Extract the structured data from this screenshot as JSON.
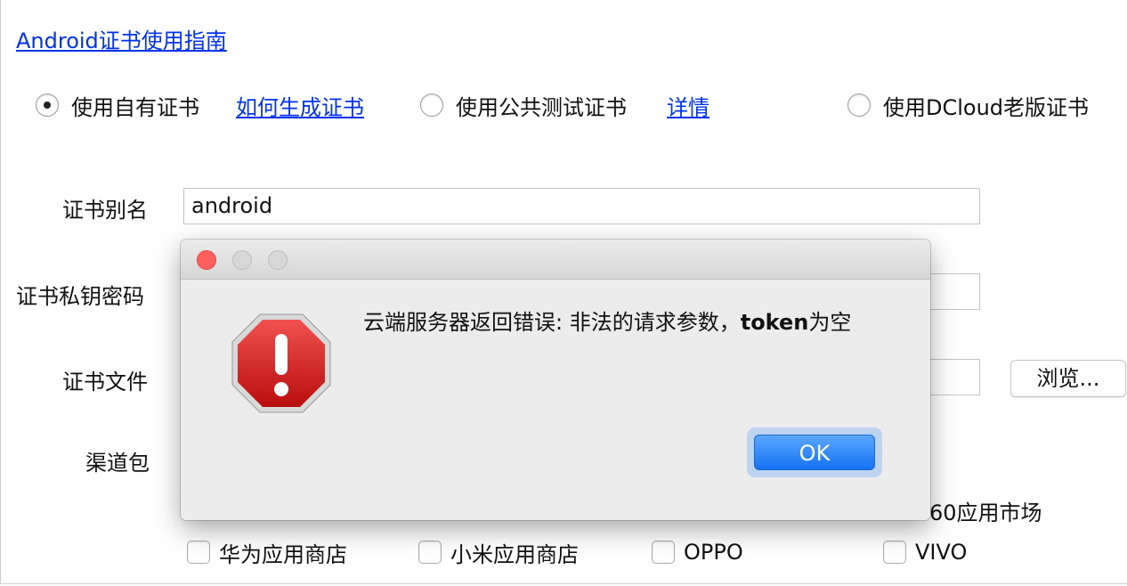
{
  "guide_link": "Android证书使用指南",
  "cert_options": [
    {
      "label": "使用自有证书",
      "checked": true,
      "link": "如何生成证书"
    },
    {
      "label": "使用公共测试证书",
      "checked": false,
      "link": "详情"
    },
    {
      "label": "使用DCloud老版证书",
      "checked": false
    }
  ],
  "form": {
    "alias_label": "证书别名",
    "alias_value": "android",
    "password_label": "证书私钥密码",
    "file_label": "证书文件",
    "browse_label": "浏览...",
    "channel_label": "渠道包"
  },
  "channels": {
    "partial_visible": "60应用市场",
    "items": [
      "华为应用商店",
      "小米应用商店",
      "OPPO",
      "VIVO"
    ]
  },
  "dialog": {
    "message_main": "云端服务器返回错误: 非法的请求参数，",
    "message_bold": "token",
    "message_tail": "为空",
    "ok_label": "OK",
    "icon": "stop-warning-icon",
    "colors": {
      "close": "#fc605c",
      "ok": "#1572f2"
    }
  }
}
